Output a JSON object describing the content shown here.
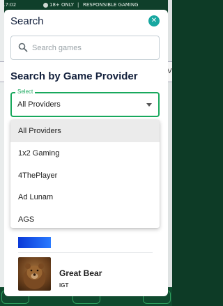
{
  "status_bar": {
    "time": "17:02",
    "age_notice": "18+ ONLY",
    "separator": "|",
    "responsible": "RESPONSIBLE GAMING"
  },
  "background": {
    "right_tab_label": "V"
  },
  "modal": {
    "title": "Search",
    "close_icon": "close-icon",
    "search": {
      "placeholder": "Search games",
      "value": ""
    },
    "provider_section_title": "Search by Game Provider",
    "provider_select": {
      "legend": "Select",
      "value": "All Providers"
    },
    "dropdown": {
      "options": [
        "All Providers",
        "1x2 Gaming",
        "4ThePlayer",
        "Ad Lunam",
        "AGS"
      ],
      "selected_index": 0
    },
    "results": [
      {
        "name": "Great Bear",
        "provider": "IGT"
      }
    ]
  },
  "colors": {
    "accent": "#18a85d",
    "close": "#17a7a0",
    "title": "#14213d",
    "status_bar": "#0f3f2a"
  }
}
